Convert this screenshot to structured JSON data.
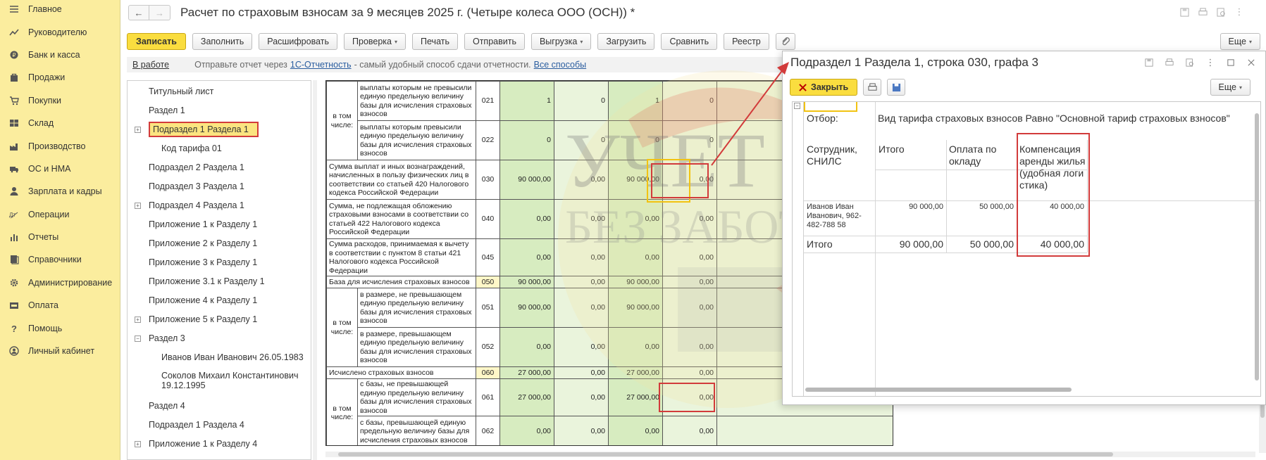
{
  "sidebar": {
    "items": [
      {
        "label": "Главное",
        "icon": "menu-icon"
      },
      {
        "label": "Руководителю",
        "icon": "trend-icon"
      },
      {
        "label": "Банк и касса",
        "icon": "coins-icon"
      },
      {
        "label": "Продажи",
        "icon": "bag-icon"
      },
      {
        "label": "Покупки",
        "icon": "cart-icon"
      },
      {
        "label": "Склад",
        "icon": "warehouse-icon"
      },
      {
        "label": "Производство",
        "icon": "factory-icon"
      },
      {
        "label": "ОС и НМА",
        "icon": "truck-icon"
      },
      {
        "label": "Зарплата и кадры",
        "icon": "person-icon"
      },
      {
        "label": "Операции",
        "icon": "operations-icon"
      },
      {
        "label": "Отчеты",
        "icon": "bar-chart-icon"
      },
      {
        "label": "Справочники",
        "icon": "books-icon"
      },
      {
        "label": "Администрирование",
        "icon": "gear-icon"
      },
      {
        "label": "Оплата",
        "icon": "payment-icon"
      },
      {
        "label": "Помощь",
        "icon": "question-icon"
      },
      {
        "label": "Личный кабинет",
        "icon": "account-icon"
      }
    ]
  },
  "window": {
    "title": "Расчет по страховым взносам за 9 месяцев 2025 г. (Четыре колеса ООО (ОСН)) *",
    "back_glyph": "←",
    "forward_glyph": "→"
  },
  "toolbar": {
    "record": "Записать",
    "fill": "Заполнить",
    "decode": "Расшифровать",
    "check": "Проверка",
    "print": "Печать",
    "send": "Отправить",
    "export": "Выгрузка",
    "load": "Загрузить",
    "compare": "Сравнить",
    "registry": "Реестр",
    "more": "Еще",
    "dropdown_glyph": "▾"
  },
  "infobar": {
    "state": "В работе",
    "text_before": "Отправьте отчет через",
    "link1": "1С-Отчетность",
    "text_after": "- самый удобный способ сдачи отчетности.",
    "link2": "Все способы"
  },
  "tree": {
    "items": [
      {
        "label": "Титульный лист",
        "level": 0,
        "toggle": ""
      },
      {
        "label": "Раздел 1",
        "level": 0,
        "toggle": ""
      },
      {
        "label": "Подраздел 1 Раздела 1",
        "level": 0,
        "toggle": "+",
        "active": true
      },
      {
        "label": "Код тарифа 01",
        "level": 1,
        "toggle": ""
      },
      {
        "label": "Подраздел 2 Раздела 1",
        "level": 0,
        "toggle": ""
      },
      {
        "label": "Подраздел 3 Раздела 1",
        "level": 0,
        "toggle": ""
      },
      {
        "label": "Подраздел 4 Раздела 1",
        "level": 0,
        "toggle": "+"
      },
      {
        "label": "Приложение 1 к Разделу 1",
        "level": 0,
        "toggle": ""
      },
      {
        "label": "Приложение 2 к Разделу 1",
        "level": 0,
        "toggle": ""
      },
      {
        "label": "Приложение 3 к Разделу 1",
        "level": 0,
        "toggle": ""
      },
      {
        "label": "Приложение 3.1 к Разделу 1",
        "level": 0,
        "toggle": ""
      },
      {
        "label": "Приложение 4 к Разделу 1",
        "level": 0,
        "toggle": ""
      },
      {
        "label": "Приложение 5 к Разделу 1",
        "level": 0,
        "toggle": "+"
      },
      {
        "label": "Раздел 3",
        "level": 0,
        "toggle": "−"
      },
      {
        "label": "Иванов Иван Иванович 26.05.1983",
        "level": 1,
        "toggle": ""
      },
      {
        "label": "Соколов Михаил Константинович 19.12.1995",
        "level": 1,
        "toggle": "",
        "wrap": true
      },
      {
        "label": "Раздел 4",
        "level": 0,
        "toggle": ""
      },
      {
        "label": "Подраздел 1 Раздела 4",
        "level": 0,
        "toggle": ""
      },
      {
        "label": "Приложение 1 к Разделу 4",
        "level": 0,
        "toggle": "+"
      }
    ]
  },
  "report": {
    "group_in_total": "в том числе:",
    "rows": [
      {
        "id": "r021",
        "label": "выплаты которым не превысили единую предельную величину базы для исчисления страховых взносов",
        "code": "021",
        "vals": [
          "1",
          "0",
          "1",
          "0"
        ],
        "group": true
      },
      {
        "id": "r022",
        "label": "выплаты которым превысили единую предельную величину базы для исчисления страховых взносов",
        "code": "022",
        "vals": [
          "0",
          "0",
          "0",
          "0"
        ],
        "group": true
      },
      {
        "id": "r030",
        "label": "Сумма выплат и иных вознаграждений, начисленных в пользу физических лиц в соответствии со статьей 420 Налогового кодекса Российской Федерации",
        "code": "030",
        "vals": [
          "90 000,00",
          "0,00",
          "90 000,00",
          "0,00"
        ]
      },
      {
        "id": "r040",
        "label": "Сумма, не подлежащая обложению страховыми взносами в соответствии со статьей 422 Налогового кодекса Российской Федерации",
        "code": "040",
        "vals": [
          "0,00",
          "0,00",
          "0,00",
          "0,00"
        ]
      },
      {
        "id": "r045",
        "label": "Сумма расходов, принимаемая к вычету в соответствии с пунктом 8 статьи 421 Налогового кодекса Российской Федерации",
        "code": "045",
        "vals": [
          "0,00",
          "0,00",
          "0,00",
          "0,00"
        ]
      },
      {
        "id": "r050",
        "label": "База для исчисления страховых взносов",
        "code": "050",
        "vals": [
          "90 000,00",
          "0,00",
          "90 000,00",
          "0,00"
        ]
      },
      {
        "id": "r051",
        "label": "в размере, не превышающем единую предельную величину базы для исчисления страховых взносов",
        "code": "051",
        "vals": [
          "90 000,00",
          "0,00",
          "90 000,00",
          "0,00"
        ],
        "group": true
      },
      {
        "id": "r052",
        "label": "в размере, превышающем единую предельную величину базы для исчисления страховых взносов",
        "code": "052",
        "vals": [
          "0,00",
          "0,00",
          "0,00",
          "0,00"
        ],
        "group": true
      },
      {
        "id": "r060",
        "label": "Исчислено страховых взносов",
        "code": "060",
        "vals": [
          "27 000,00",
          "0,00",
          "27 000,00",
          "0,00"
        ]
      },
      {
        "id": "r061",
        "label": "с базы, не превышающей единую предельную величину базы для исчисления страховых взносов",
        "code": "061",
        "vals": [
          "27 000,00",
          "0,00",
          "27 000,00",
          "0,00"
        ],
        "group": true
      },
      {
        "id": "r062",
        "label": "с базы, превышающей единую предельную величину базы для исчисления страховых взносов",
        "code": "062",
        "vals": [
          "0,00",
          "0,00",
          "0,00",
          "0,00"
        ],
        "group": true
      }
    ]
  },
  "dialog": {
    "title": "Подраздел 1 Раздела 1, строка 030, графа 3",
    "close": "Закрыть",
    "more": "Еще",
    "filter_label": "Отбор:",
    "filter_value": "Вид тарифа страховых взносов Равно \"Основной тариф страховых взносов\"",
    "columns": {
      "employee": "Сотрудник, СНИЛС",
      "total": "Итого",
      "salary": "Оплата по окладу",
      "housing": "Компенсация аренды жилья (удобная логистика)"
    },
    "rows": [
      {
        "employee": "Иванов Иван Иванович, 962-482-788 58",
        "total": "90 000,00",
        "salary": "50 000,00",
        "housing": "40 000,00"
      }
    ],
    "totals": {
      "label": "Итого",
      "total": "90 000,00",
      "salary": "50 000,00",
      "housing": "40 000,00"
    }
  },
  "watermark": {
    "line1": "УЧЕТ",
    "line2": "БЕЗ ЗАБОТ"
  },
  "colors": {
    "accent_yellow": "#fadd3f",
    "sidebar": "#fbed9e",
    "highlight_red": "#d23b3b",
    "cell_green": "#eaf4dc"
  }
}
